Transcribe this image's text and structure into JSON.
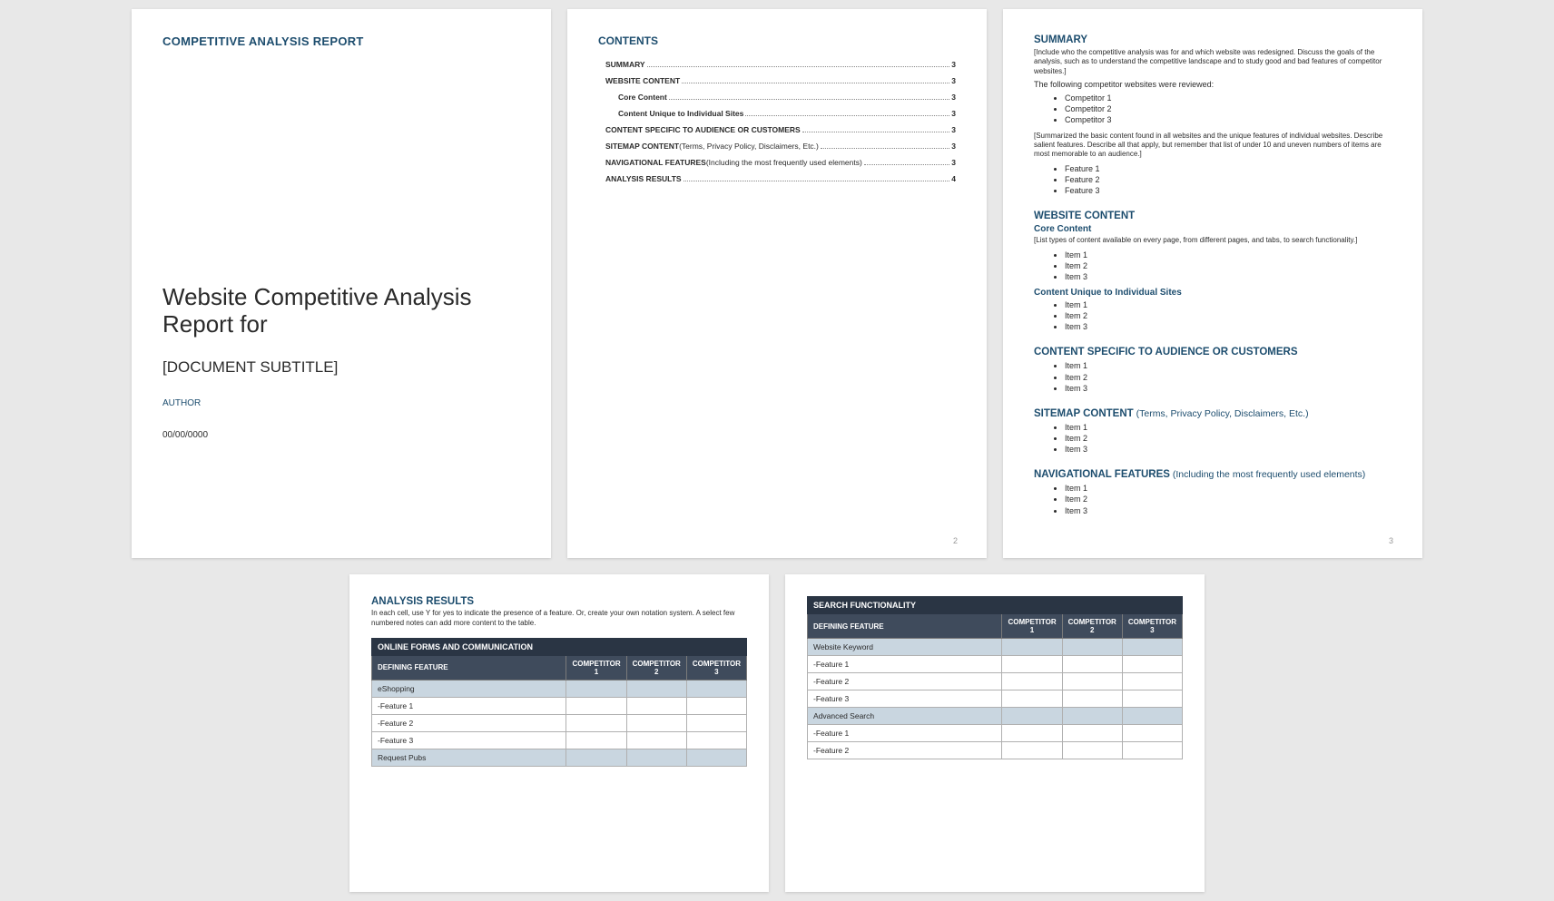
{
  "page1": {
    "header": "COMPETITIVE ANALYSIS REPORT",
    "title": "Website Competitive Analysis Report for",
    "subtitle": "[DOCUMENT SUBTITLE]",
    "author": "AUTHOR",
    "date": "00/00/0000"
  },
  "page2": {
    "title": "CONTENTS",
    "toc": [
      {
        "label": "SUMMARY",
        "page": "3",
        "level": 1
      },
      {
        "label": "WEBSITE CONTENT",
        "page": "3",
        "level": 1
      },
      {
        "label": "Core Content",
        "page": "3",
        "level": 2
      },
      {
        "label": "Content Unique to Individual Sites",
        "page": "3",
        "level": 2
      },
      {
        "label": "CONTENT SPECIFIC TO AUDIENCE OR CUSTOMERS",
        "page": "3",
        "level": 1
      },
      {
        "label": "SITEMAP CONTENT",
        "note": " (Terms, Privacy Policy, Disclaimers, Etc.)",
        "page": "3",
        "level": 1
      },
      {
        "label": "NAVIGATIONAL FEATURES",
        "note": " (Including the most frequently used elements)",
        "page": "3",
        "level": 1
      },
      {
        "label": "ANALYSIS RESULTS",
        "page": "4",
        "level": 1
      }
    ],
    "pagenum": "2"
  },
  "page3": {
    "summary": {
      "title": "SUMMARY",
      "note1": "[Include who the competitive analysis was for and which website was redesigned. Discuss the goals of the analysis, such as to understand the competitive landscape and to study good and bad features of competitor websites.]",
      "reviewed_intro": "The following competitor websites were reviewed:",
      "competitors": [
        "Competitor 1",
        "Competitor 2",
        "Competitor 3"
      ],
      "note2": "[Summarized the basic content found in all websites and the unique features of individual websites. Describe salient features. Describe all that apply, but remember that list of under 10 and uneven numbers of items are most memorable to an audience.]",
      "features": [
        "Feature 1",
        "Feature 2",
        "Feature 3"
      ]
    },
    "website_content": {
      "title": "WEBSITE CONTENT",
      "core": {
        "title": "Core Content",
        "note": "[List types of content available on every page, from different pages, and tabs, to search functionality.]",
        "items": [
          "Item 1",
          "Item 2",
          "Item 3"
        ]
      },
      "unique": {
        "title": "Content Unique to Individual Sites",
        "items": [
          "Item 1",
          "Item 2",
          "Item 3"
        ]
      }
    },
    "audience": {
      "title": "CONTENT SPECIFIC TO AUDIENCE OR CUSTOMERS",
      "items": [
        "Item 1",
        "Item 2",
        "Item 3"
      ]
    },
    "sitemap": {
      "title": "SITEMAP CONTENT",
      "title_note": " (Terms, Privacy Policy, Disclaimers, Etc.)",
      "items": [
        "Item 1",
        "Item 2",
        "Item 3"
      ]
    },
    "nav": {
      "title": "NAVIGATIONAL FEATURES",
      "title_note": " (Including the most frequently used elements)",
      "items": [
        "Item 1",
        "Item 2",
        "Item 3"
      ]
    },
    "pagenum": "3"
  },
  "page4": {
    "title": "ANALYSIS RESULTS",
    "note": "In each cell, use Y for yes to indicate the presence of a feature. Or, create your own notation system. A select few numbered notes can add more content to the table.",
    "table": {
      "super": "ONLINE FORMS AND COMMUNICATION",
      "defining_label": "DEFINING FEATURE",
      "cols": [
        "COMPETITOR 1",
        "COMPETITOR 2",
        "COMPETITOR 3"
      ],
      "rows": [
        {
          "label": "eShopping",
          "group": true
        },
        {
          "label": "-Feature 1",
          "group": false
        },
        {
          "label": "-Feature 2",
          "group": false
        },
        {
          "label": "-Feature 3",
          "group": false
        },
        {
          "label": "Request Pubs",
          "group": true
        }
      ]
    }
  },
  "page5": {
    "table": {
      "super": "SEARCH FUNCTIONALITY",
      "defining_label": "DEFINING FEATURE",
      "cols": [
        "COMPETITOR 1",
        "COMPETITOR 2",
        "COMPETITOR 3"
      ],
      "rows": [
        {
          "label": "Website Keyword",
          "group": true
        },
        {
          "label": "-Feature 1",
          "group": false
        },
        {
          "label": "-Feature 2",
          "group": false
        },
        {
          "label": "-Feature 3",
          "group": false
        },
        {
          "label": "Advanced Search",
          "group": true
        },
        {
          "label": "-Feature 1",
          "group": false
        },
        {
          "label": "-Feature 2",
          "group": false
        }
      ]
    }
  }
}
